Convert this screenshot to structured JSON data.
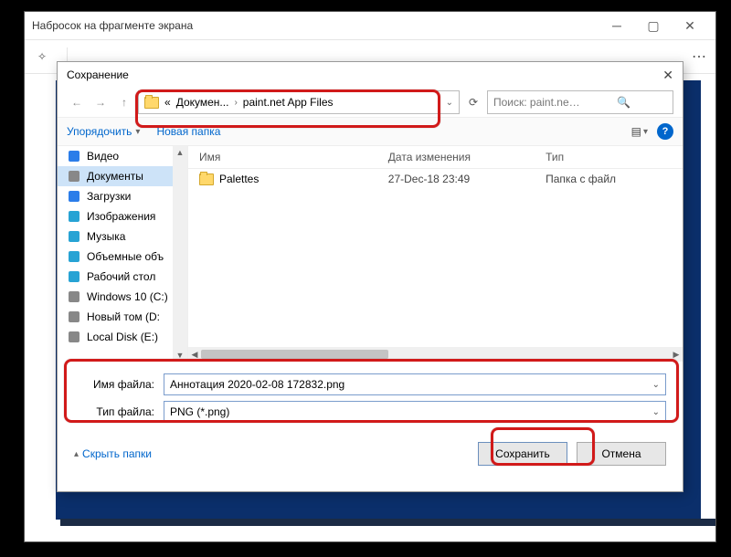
{
  "parent_window": {
    "title": "Набросок на фрагменте экрана"
  },
  "dialog": {
    "title": "Сохранение",
    "path": {
      "prefix": "«",
      "seg1": "Докумен...",
      "seg2": "paint.net App Files"
    },
    "search_placeholder": "Поиск: paint.net App Files",
    "toolbar": {
      "organize": "Упорядочить",
      "new_folder": "Новая папка"
    },
    "sidebar": {
      "items": [
        {
          "label": "Видео",
          "color": "#2b7de9"
        },
        {
          "label": "Документы",
          "color": "#888",
          "selected": true
        },
        {
          "label": "Загрузки",
          "color": "#2b7de9"
        },
        {
          "label": "Изображения",
          "color": "#27a3d4"
        },
        {
          "label": "Музыка",
          "color": "#27a3d4"
        },
        {
          "label": "Объемные объ",
          "color": "#27a3d4"
        },
        {
          "label": "Рабочий стол",
          "color": "#27a3d4"
        },
        {
          "label": "Windows 10 (C:)",
          "color": "#888"
        },
        {
          "label": "Новый том (D:",
          "color": "#888"
        },
        {
          "label": "Local Disk (E:)",
          "color": "#888"
        }
      ]
    },
    "columns": {
      "name": "Имя",
      "modified": "Дата изменения",
      "type": "Тип"
    },
    "rows": [
      {
        "name": "Palettes",
        "modified": "27-Dec-18 23:49",
        "type": "Папка с файл"
      }
    ],
    "fields": {
      "filename_label": "Имя файла:",
      "filename_value": "Аннотация 2020-02-08 172832.png",
      "filetype_label": "Тип файла:",
      "filetype_value": "PNG (*.png)"
    },
    "footer": {
      "hide_folders": "Скрыть папки",
      "save": "Сохранить",
      "cancel": "Отмена"
    }
  }
}
